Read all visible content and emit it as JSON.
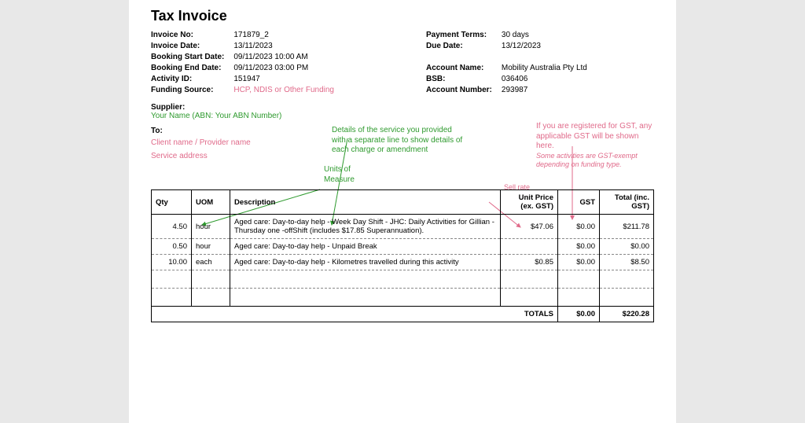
{
  "title": "Tax Invoice",
  "meta_left": {
    "labels": [
      "Invoice No:",
      "Invoice Date:",
      "Booking Start Date:",
      "Booking End Date:",
      "Activity ID:",
      "Funding Source:"
    ],
    "values": [
      "171879_2",
      "13/11/2023",
      "09/11/2023 10:00 AM",
      "09/11/2023 03:00 PM",
      "151947"
    ],
    "funding_source_note": "HCP, NDIS or Other Funding"
  },
  "meta_right": {
    "labels": [
      "Payment Terms:",
      "Due Date:",
      "",
      "Account Name:",
      "BSB:",
      "Account Number:"
    ],
    "values": [
      "30 days",
      "13/12/2023",
      "",
      "Mobility Australia Pty Ltd",
      "036406",
      "293987"
    ]
  },
  "supplier_label": "Supplier:",
  "supplier_note": "Your Name (ABN: Your ABN Number)",
  "to_label": "To:",
  "to_line1": "Client name / Provider name",
  "to_line2": "Service address",
  "annot_uom": "Units of Measure",
  "annot_service": "Details of the service you provided with a separate line to show details of each charge or amendment",
  "annot_gst_main": "If you are registered for GST, any applicable GST will be shown here.",
  "annot_gst_sub": "Some activities are GST-exempt depending on funding type.",
  "annot_sellrate": "Sell rate",
  "table": {
    "headers": {
      "qty": "Qty",
      "uom": "UOM",
      "desc": "Description",
      "unit": "Unit Price (ex. GST)",
      "gst": "GST",
      "total": "Total (inc. GST)"
    },
    "rows": [
      {
        "qty": "4.50",
        "uom": "hour",
        "desc": "Aged care: Day-to-day help - Week Day Shift - JHC: Daily Activities for Gillian - Thursday one -offShift (includes $17.85 Superannuation).",
        "unit": "$47.06",
        "gst": "$0.00",
        "total": "$211.78"
      },
      {
        "qty": "0.50",
        "uom": "hour",
        "desc": "Aged care: Day-to-day help - Unpaid Break",
        "unit": "",
        "gst": "$0.00",
        "total": "$0.00"
      },
      {
        "qty": "10.00",
        "uom": "each",
        "desc": "Aged care: Day-to-day help - Kilometres travelled during this activity",
        "unit": "$0.85",
        "gst": "$0.00",
        "total": "$8.50"
      }
    ],
    "totals_label": "TOTALS",
    "totals_gst": "$0.00",
    "totals_total": "$220.28"
  }
}
